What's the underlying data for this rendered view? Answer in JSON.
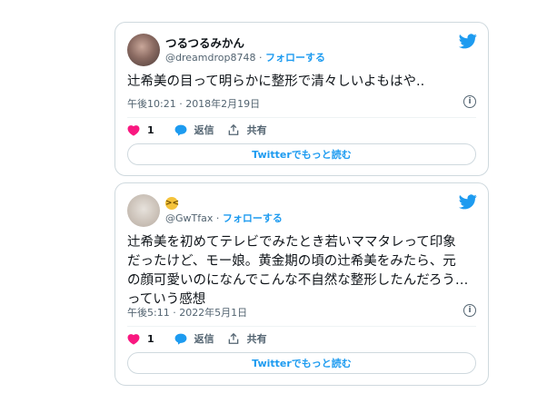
{
  "tweets": [
    {
      "name": "つるつるみかん",
      "handle": "@dreamdrop8748",
      "follow_label": "フォローする",
      "text": "辻希美の目って明らかに整形で清々しいよもはや..",
      "timestamp": "午後10:21 · 2018年2月19日",
      "likes": "1",
      "reply_label": "返信",
      "share_label": "共有",
      "more_label": "Twitterでもっと読む"
    },
    {
      "name_emoji": "😩",
      "handle": "@GwTfax",
      "follow_label": "フォローする",
      "text_lines": [
        "辻希美を初めてテレビでみたとき若いママタレって印象",
        "だったけど、モー娘。黄金期の頃の辻希美をみたら、元",
        "の顔可愛いのになんでこんな不自然な整形したんだろう…",
        "っていう感想"
      ],
      "timestamp": "午後5:11 · 2022年5月1日",
      "likes": "1",
      "reply_label": "返信",
      "share_label": "共有",
      "more_label": "Twitterでもっと読む"
    }
  ],
  "colors": {
    "accent": "#1d9bf0",
    "like": "#f91880",
    "secondary": "#536471",
    "border": "#cfd9de"
  },
  "icons": [
    "twitter-bird-icon",
    "heart-icon",
    "reply-bubble-icon",
    "share-icon",
    "info-icon"
  ]
}
